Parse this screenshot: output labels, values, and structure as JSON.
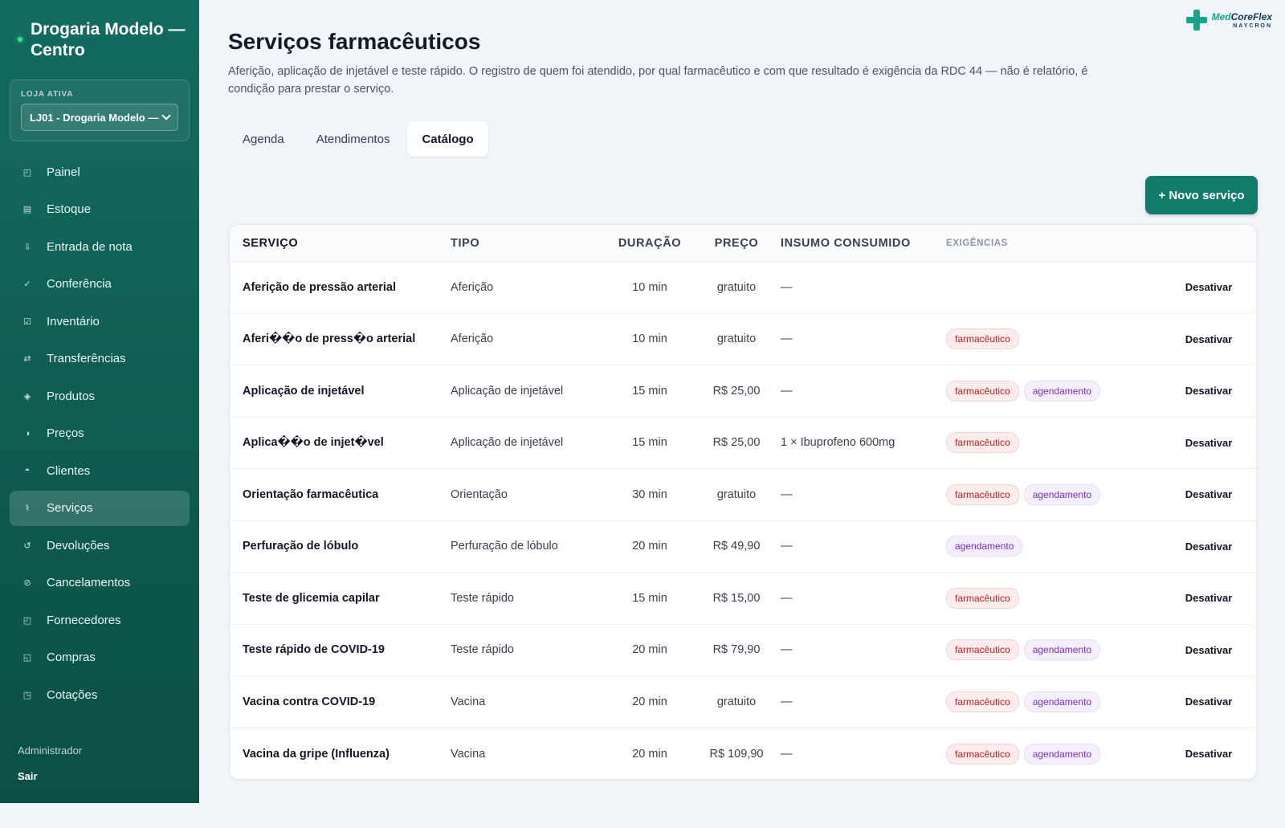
{
  "sidebar": {
    "brand": "Drogaria Modelo — Centro",
    "store_label": "LOJA ATIVA",
    "store_value": "LJ01 - Drogaria Modelo —",
    "items": [
      {
        "icon": "◰",
        "label": "Painel"
      },
      {
        "icon": "▤",
        "label": "Estoque"
      },
      {
        "icon": "⇩",
        "label": "Entrada de nota"
      },
      {
        "icon": "✓",
        "label": "Conferência"
      },
      {
        "icon": "☑",
        "label": "Inventário"
      },
      {
        "icon": "⇄",
        "label": "Transferências"
      },
      {
        "icon": "◈",
        "label": "Produtos"
      },
      {
        "icon": "◑",
        "label": "Preços"
      },
      {
        "icon": "◓",
        "label": "Clientes"
      },
      {
        "icon": "⚕",
        "label": "Serviços"
      },
      {
        "icon": "↺",
        "label": "Devoluções"
      },
      {
        "icon": "⊘",
        "label": "Cancelamentos"
      },
      {
        "icon": "◰",
        "label": "Fornecedores"
      },
      {
        "icon": "◱",
        "label": "Compras"
      },
      {
        "icon": "◳",
        "label": "Cotações"
      }
    ],
    "active_index": 9,
    "user_role": "Administrador",
    "logout": "Sair"
  },
  "logo": {
    "med": "Med",
    "core": "CoreFlex",
    "sub": "NAYCRON"
  },
  "header": {
    "title": "Serviços farmacêuticos",
    "description": "Aferição, aplicação de injetável e teste rápido. O registro de quem foi atendido, por qual farmacêutico e com que resultado é exigência da RDC 44 — não é relatório, é condição para prestar o serviço."
  },
  "tabs": [
    {
      "label": "Agenda",
      "active": false
    },
    {
      "label": "Atendimentos",
      "active": false
    },
    {
      "label": "Catálogo",
      "active": true
    }
  ],
  "new_button": "+ Novo serviço",
  "table": {
    "headers": {
      "name": "Serviço",
      "type": "Tipo",
      "duration": "Duração",
      "price": "Preço",
      "supply": "Insumo consumido",
      "requirements": "Exigências"
    },
    "action_label": "Desativar",
    "badge_labels": {
      "farm": "farmacêutico",
      "ag": "agendamento"
    },
    "rows": [
      {
        "name": "Aferição de pressão arterial",
        "type": "Aferição",
        "duration": "10 min",
        "price": "gratuito",
        "supply": "—",
        "farm": false,
        "ag": false
      },
      {
        "name": "Aferi��o de press�o arterial",
        "type": "Aferição",
        "duration": "10 min",
        "price": "gratuito",
        "supply": "—",
        "farm": true,
        "ag": false
      },
      {
        "name": "Aplicação de injetável",
        "type": "Aplicação de injetável",
        "duration": "15 min",
        "price": "R$ 25,00",
        "supply": "—",
        "farm": true,
        "ag": true
      },
      {
        "name": "Aplica��o de injet�vel",
        "type": "Aplicação de injetável",
        "duration": "15 min",
        "price": "R$ 25,00",
        "supply": "1 × Ibuprofeno 600mg",
        "farm": true,
        "ag": false
      },
      {
        "name": "Orientação farmacêutica",
        "type": "Orientação",
        "duration": "30 min",
        "price": "gratuito",
        "supply": "—",
        "farm": true,
        "ag": true
      },
      {
        "name": "Perfuração de lóbulo",
        "type": "Perfuração de lóbulo",
        "duration": "20 min",
        "price": "R$ 49,90",
        "supply": "—",
        "farm": false,
        "ag": true
      },
      {
        "name": "Teste de glicemia capilar",
        "type": "Teste rápido",
        "duration": "15 min",
        "price": "R$ 15,00",
        "supply": "—",
        "farm": true,
        "ag": false
      },
      {
        "name": "Teste rápido de COVID-19",
        "type": "Teste rápido",
        "duration": "20 min",
        "price": "R$ 79,90",
        "supply": "—",
        "farm": true,
        "ag": true
      },
      {
        "name": "Vacina contra COVID-19",
        "type": "Vacina",
        "duration": "20 min",
        "price": "gratuito",
        "supply": "—",
        "farm": true,
        "ag": true
      },
      {
        "name": "Vacina da gripe (Influenza)",
        "type": "Vacina",
        "duration": "20 min",
        "price": "R$ 109,90",
        "supply": "—",
        "farm": true,
        "ag": true
      }
    ]
  }
}
